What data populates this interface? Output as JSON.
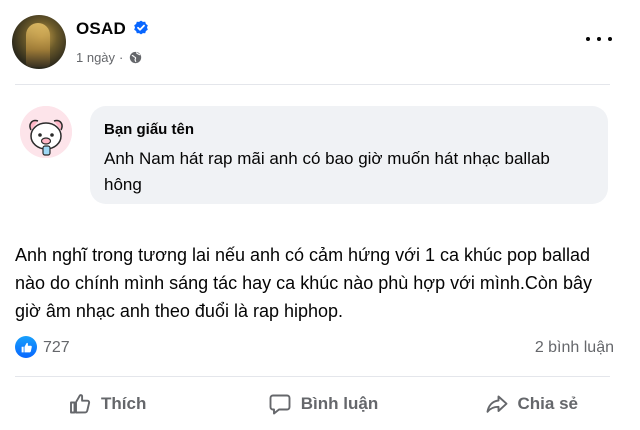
{
  "post": {
    "author": "OSAD",
    "time": "1 ngày"
  },
  "question": {
    "asker": "Bạn giấu tên",
    "text": "Anh Nam hát rap mãi anh có bao giờ muốn hát nhạc ballab hông"
  },
  "answer": {
    "text": "Anh nghĩ trong tương lai nếu anh có cảm hứng với 1 ca khúc pop ballad nào do chính mình sáng tác hay ca khúc nào phù hợp với mình.Còn bây giờ âm nhạc anh theo đuổi là rap hiphop."
  },
  "stats": {
    "likes": "727",
    "comments": "2 bình luận"
  },
  "actions": {
    "like": "Thích",
    "comment": "Bình luận",
    "share": "Chia sẻ"
  },
  "colors": {
    "accent": "#0866ff",
    "muted_text": "#65676b",
    "bubble": "#f0f2f5"
  },
  "icons": [
    "verified-badge-icon",
    "globe-icon",
    "more-options-icon",
    "like-reaction-icon",
    "like-icon",
    "comment-icon",
    "share-icon"
  ]
}
